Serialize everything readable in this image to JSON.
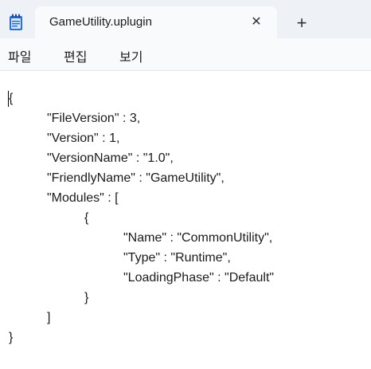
{
  "tab": {
    "title": "GameUtility.uplugin",
    "close_glyph": "✕",
    "new_tab_glyph": "+"
  },
  "menu": {
    "file": "파일",
    "edit": "편집",
    "view": "보기"
  },
  "document": {
    "lines": [
      "{",
      "\"FileVersion\" : 3,",
      "\"Version\" : 1,",
      "\"VersionName\" : \"1.0\",",
      "\"FriendlyName\" : \"GameUtility\",",
      "\"Modules\" : [",
      "{",
      "\"Name\" : \"CommonUtility\",",
      "\"Type\" : \"Runtime\",",
      "\"LoadingPhase\" : \"Default\"",
      "}",
      "]",
      "}"
    ]
  },
  "colors": {
    "tab_strip": "#eef2f7",
    "active_tab": "#f9fafb",
    "editor_bg": "#ffffff",
    "icon_blue": "#2b6fd6"
  }
}
